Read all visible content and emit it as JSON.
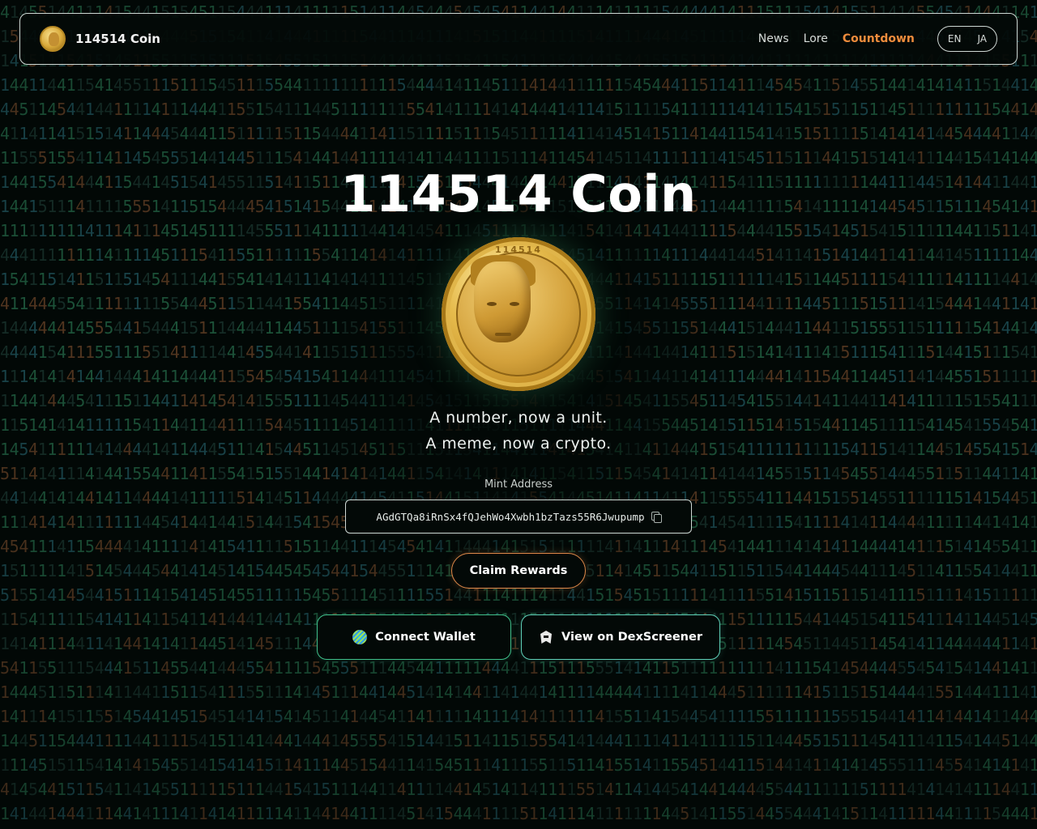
{
  "header": {
    "brand_name": "114514 Coin",
    "nav": [
      "News",
      "Lore",
      "Countdown"
    ],
    "active_nav": "Countdown",
    "lang": [
      "EN",
      "JA"
    ]
  },
  "hero": {
    "title": "114514 Coin",
    "coin_engraving": "114514",
    "tagline_1": "A number, now a unit.",
    "tagline_2": "A meme, now a crypto."
  },
  "mint": {
    "label": "Mint Address",
    "address": "AGdGTQa8iRnSx4fQJehWo4Xwbh1bzTazs55R6Jwupump"
  },
  "buttons": {
    "claim": "Claim Rewards",
    "connect_wallet": "Connect Wallet",
    "dexscreener": "View on DexScreener"
  },
  "colors": {
    "accent_orange": "#ef8c3c",
    "accent_green": "#3fbf8a",
    "background": "#020806"
  },
  "icons": [
    "copy-icon",
    "wallet-icon",
    "dexscreener-icon",
    "coin-logo"
  ]
}
